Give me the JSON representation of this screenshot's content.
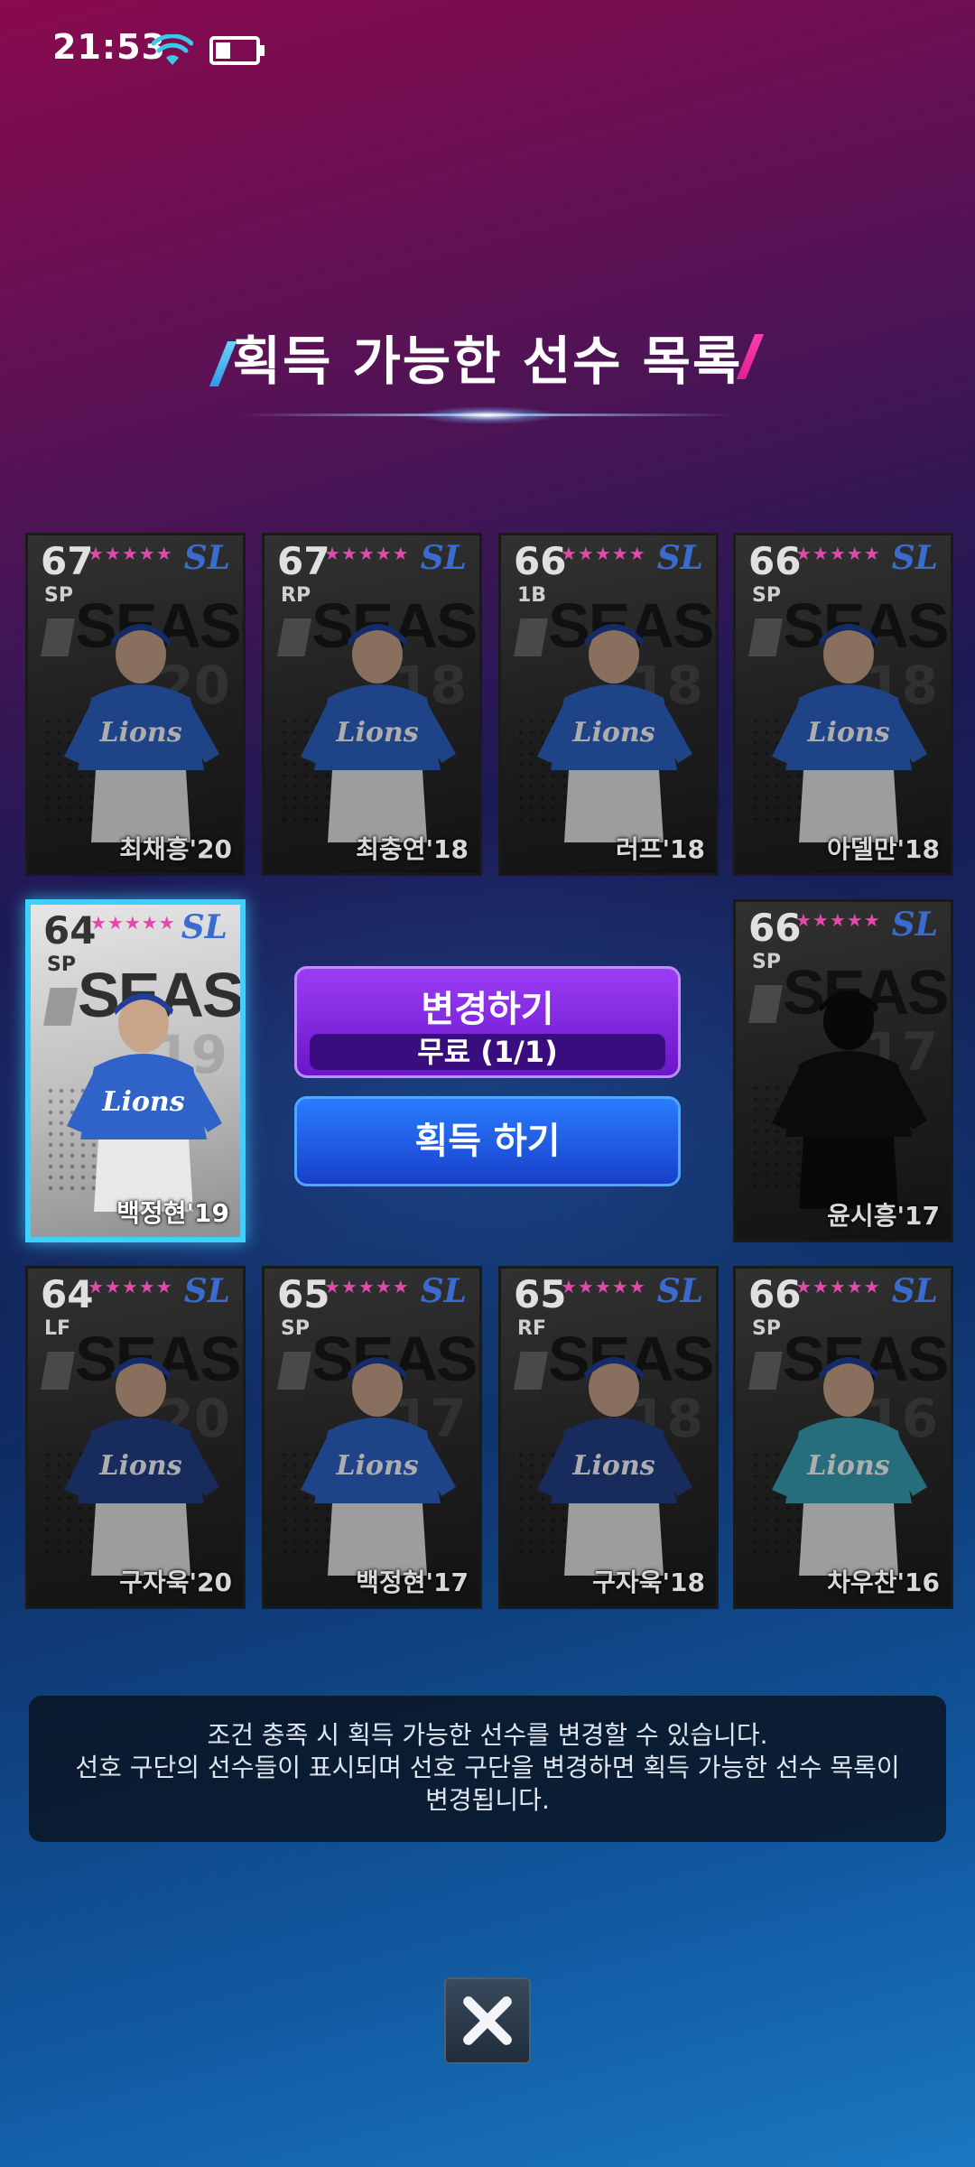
{
  "status": {
    "time": "21:53"
  },
  "title": "획득 가능한 선수 목록",
  "cards": [
    {
      "ovr": "67",
      "pos": "SP",
      "name": "최채흥'20",
      "year": "20",
      "selected": false,
      "uniform": "#2f63c8",
      "silhouette": false
    },
    {
      "ovr": "67",
      "pos": "RP",
      "name": "최충연'18",
      "year": "18",
      "selected": false,
      "uniform": "#2f63c8",
      "silhouette": false
    },
    {
      "ovr": "66",
      "pos": "1B",
      "name": "러프'18",
      "year": "18",
      "selected": false,
      "uniform": "#2f63c8",
      "silhouette": false
    },
    {
      "ovr": "66",
      "pos": "SP",
      "name": "아델만'18",
      "year": "18",
      "selected": false,
      "uniform": "#2f63c8",
      "silhouette": false
    },
    {
      "ovr": "64",
      "pos": "SP",
      "name": "백정현'19",
      "year": "19",
      "selected": true,
      "uniform": "#2f63c8",
      "silhouette": false
    },
    {
      "ovr": "66",
      "pos": "SP",
      "name": "윤시흥'17",
      "year": "17",
      "selected": false,
      "uniform": "#111111",
      "silhouette": true
    },
    {
      "ovr": "64",
      "pos": "LF",
      "name": "구자욱'20",
      "year": "20",
      "selected": false,
      "uniform": "#22408a",
      "silhouette": false
    },
    {
      "ovr": "65",
      "pos": "SP",
      "name": "백정현'17",
      "year": "17",
      "selected": false,
      "uniform": "#2f63c8",
      "silhouette": false
    },
    {
      "ovr": "65",
      "pos": "RF",
      "name": "구자욱'18",
      "year": "18",
      "selected": false,
      "uniform": "#22408a",
      "silhouette": false
    },
    {
      "ovr": "66",
      "pos": "SP",
      "name": "차우찬'16",
      "year": "16",
      "selected": false,
      "uniform": "#3aa3b8",
      "silhouette": false
    }
  ],
  "card_common": {
    "season": "SEASON",
    "logo": "SL",
    "stars": "★★★★★"
  },
  "buttons": {
    "change_label": "변경하기",
    "change_sub": "무료 (1/1)",
    "acquire_label": "획득 하기"
  },
  "info": {
    "line1": "조건 충족 시 획득 가능한 선수를 변경할 수 있습니다.",
    "line2": "선호 구단의 선수들이 표시되며 선호 구단을 변경하면 획득 가능한 선수 목록이",
    "line3": "변경됩니다."
  },
  "icons": {
    "wifi": "wifi-icon",
    "battery": "battery-icon",
    "close": "close-icon"
  }
}
